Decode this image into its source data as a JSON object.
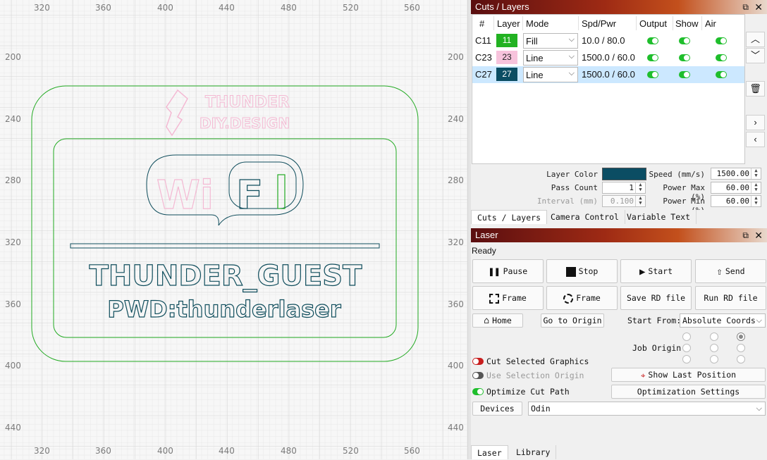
{
  "canvas": {
    "ruler_top": [
      "320",
      "360",
      "400",
      "440",
      "480",
      "520",
      "560"
    ],
    "ruler_left": [
      "200",
      "240",
      "280",
      "320",
      "360",
      "400",
      "440"
    ],
    "design": {
      "logo_line1": "THUNDER",
      "logo_line2": "DIY.DESIGN",
      "wifi_left": "Wi",
      "wifi_right": "Fi",
      "ssid": "THUNDER_GUEST",
      "password": "PWD:thunderlaser"
    },
    "colors": {
      "green": "#22aa22",
      "teal": "#0f4d5c",
      "pink": "#f4b9d3"
    }
  },
  "cuts_panel": {
    "title": "Cuts / Layers",
    "float_icon": "float-icon",
    "close_icon": "close-icon",
    "headers": [
      "#",
      "Layer",
      "Mode",
      "Spd/Pwr",
      "Output",
      "Show",
      "Air"
    ],
    "rows": [
      {
        "id": "C11",
        "layer": "11",
        "color": "#22b222",
        "text_color": "#ffffff",
        "mode": "Fill",
        "spd_pwr": "10.0 / 80.0",
        "output": true,
        "show": true,
        "air": true
      },
      {
        "id": "C23",
        "layer": "23",
        "color": "#f7c3dc",
        "text_color": "#222222",
        "mode": "Line",
        "spd_pwr": "1500.0 / 60.0",
        "output": true,
        "show": true,
        "air": true
      },
      {
        "id": "C27",
        "layer": "27",
        "color": "#0b4d63",
        "text_color": "#ffffff",
        "mode": "Line",
        "spd_pwr": "1500.0 / 60.0",
        "output": true,
        "show": true,
        "air": true,
        "selected": true
      }
    ],
    "side_buttons": [
      "chevron-up-icon",
      "chevron-down-icon",
      "trash-icon",
      "chevron-right-icon",
      "chevron-left-icon"
    ],
    "props": {
      "layer_color_label": "Layer Color",
      "layer_color": "#0b4d63",
      "pass_count_label": "Pass Count",
      "pass_count": "1",
      "interval_label": "Interval (mm)",
      "interval": "0.100",
      "speed_label": "Speed (mm/s)",
      "speed": "1500.00",
      "power_max_label": "Power Max (%)",
      "power_max": "60.00",
      "power_min_label": "Power Min (%)",
      "power_min": "60.00"
    },
    "tabs": [
      "Cuts / Layers",
      "Camera Control",
      "Variable Text"
    ]
  },
  "laser_panel": {
    "title": "Laser",
    "status": "Ready",
    "buttons": {
      "pause": "Pause",
      "stop": "Stop",
      "start": "Start",
      "send": "Send",
      "frame1": "Frame",
      "frame2": "Frame",
      "save_rd": "Save RD file",
      "run_rd": "Run RD file",
      "home": "Home",
      "go_origin": "Go to Origin"
    },
    "start_from_label": "Start From:",
    "start_from_value": "Absolute Coords",
    "job_origin_label": "Job Origin",
    "cut_selected_label": "Cut Selected Graphics",
    "use_selection_origin_label": "Use Selection Origin",
    "optimize_cut_label": "Optimize Cut Path",
    "show_last_position": "Show Last Position",
    "optimization_settings": "Optimization Settings",
    "devices_label": "Devices",
    "device_value": "Odin",
    "tabs": [
      "Laser",
      "Library"
    ]
  }
}
